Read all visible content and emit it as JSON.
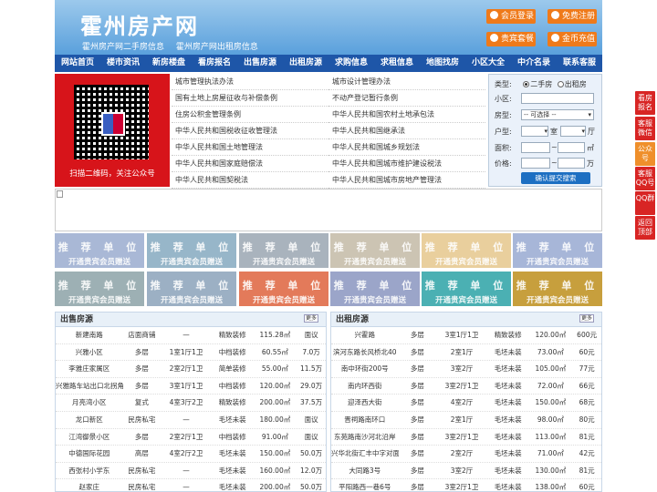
{
  "header": {
    "logo": "霍州房产网",
    "tagline": [
      "霍州房产网二手房信息",
      "霍州房产网出租房信息"
    ],
    "buttons": [
      "会员登录",
      "免费注册",
      "贵宾套餐",
      "金币充值"
    ]
  },
  "nav": [
    "网站首页",
    "楼市资讯",
    "新房楼盘",
    "看房报名",
    "出售房源",
    "出租房源",
    "求购信息",
    "求租信息",
    "地图找房",
    "小区大全",
    "中介名录",
    "联系客服"
  ],
  "qr": {
    "caption": "扫描二维码，关注公众号"
  },
  "laws_left": [
    "城市管理执法办法",
    "国有土地上房屋征收与补偿条例",
    "住房公积金管理条例",
    "中华人民共和国税收征收管理法",
    "中华人民共和国土地管理法",
    "中华人民共和国家庭赔偿法",
    "中华人民共和国契税法"
  ],
  "laws_right": [
    "城市设计管理办法",
    "不动产登记暂行条例",
    "中华人民共和国农村土地承包法",
    "中华人民共和国继承法",
    "中华人民共和国城乡规划法",
    "中华人民共和国城市维护建设税法",
    "中华人民共和国城市房地产管理法"
  ],
  "search": {
    "type_label": "类型:",
    "type_options": [
      "二手房",
      "出租房"
    ],
    "community_label": "小区:",
    "housing_label": "房型:",
    "housing_value": "-- 可选择 --",
    "layout_label": "户型:",
    "room_unit": "室",
    "hall_unit": "厅",
    "area_label": "面积:",
    "area_unit": "㎡",
    "price_label": "价格:",
    "price_unit": "万",
    "tilde": "~",
    "submit": "确认提交搜索"
  },
  "recommend": {
    "title": "推 荐 单 位",
    "subtitle": "开通贵宾会员赠送",
    "colors": [
      "#a9b8d6",
      "#97b6c9",
      "#a9b3bd",
      "#ccc4b3",
      "#e9cf9d",
      "#a7b6d8",
      "#9db0b4",
      "#9cb0c4",
      "#e37a5a",
      "#9ba5c9",
      "#4bb0b3",
      "#c79f3d"
    ]
  },
  "sale": {
    "title": "出售房源",
    "more": "更多",
    "rows": [
      [
        "新建南路",
        "店面商铺",
        "—",
        "精致装修",
        "115.28㎡",
        "面议"
      ],
      [
        "兴雅小区",
        "多层",
        "1室1厅1卫",
        "中档装修",
        "60.55㎡",
        "7.0万"
      ],
      [
        "李雅庄家属区",
        "多层",
        "2室2厅1卫",
        "简单装修",
        "55.00㎡",
        "11.5万"
      ],
      [
        "兴雅路车站出口北拐角",
        "多层",
        "3室1厅1卫",
        "中档装修",
        "120.00㎡",
        "29.0万"
      ],
      [
        "月亮湾小区",
        "复式",
        "4室3厅2卫",
        "精致装修",
        "200.00㎡",
        "37.5万"
      ],
      [
        "龙口新区",
        "民房私宅",
        "—",
        "毛坯未装",
        "180.00㎡",
        "面议"
      ],
      [
        "江湾御景小区",
        "多层",
        "2室2厅1卫",
        "中档装修",
        "91.00㎡",
        "面议"
      ],
      [
        "中德国际花园",
        "高层",
        "4室2厅2卫",
        "毛坯未装",
        "150.00㎡",
        "50.0万"
      ],
      [
        "西张村小学东",
        "民房私宅",
        "—",
        "毛坯未装",
        "160.00㎡",
        "12.0万"
      ],
      [
        "赵家庄",
        "民房私宅",
        "—",
        "毛坯未装",
        "200.00㎡",
        "50.0万"
      ]
    ]
  },
  "rent": {
    "title": "出租房源",
    "more": "更多",
    "rows": [
      [
        "兴霍路",
        "多层",
        "3室1厅1卫",
        "精致装修",
        "120.00㎡",
        "600元"
      ],
      [
        "滨河东路长风桥北40",
        "多层",
        "2室1厅",
        "毛坯未装",
        "73.00㎡",
        "60元"
      ],
      [
        "南中环街200号",
        "多层",
        "3室2厅",
        "毛坯未装",
        "105.00㎡",
        "77元"
      ],
      [
        "南内环西街",
        "多层",
        "3室2厅1卫",
        "毛坯未装",
        "72.00㎡",
        "66元"
      ],
      [
        "迎泽西大街",
        "多层",
        "4室2厅",
        "毛坯未装",
        "150.00㎡",
        "68元"
      ],
      [
        "晋祠路南环口",
        "多层",
        "2室1厅",
        "毛坯未装",
        "98.00㎡",
        "80元"
      ],
      [
        "东苑路南沙河北沿岸",
        "多层",
        "3室2厅1卫",
        "毛坯未装",
        "113.00㎡",
        "81元"
      ],
      [
        "兴华北街汇丰中字对面",
        "多层",
        "2室2厅",
        "毛坯未装",
        "71.00㎡",
        "42元"
      ],
      [
        "大同路3号",
        "多层",
        "3室2厅",
        "毛坯未装",
        "130.00㎡",
        "81元"
      ],
      [
        "平阳路西一巷6号",
        "多层",
        "3室2厅1卫",
        "毛坯未装",
        "138.00㎡",
        "60元"
      ]
    ]
  },
  "side": [
    "看房报名",
    "客服微信",
    "公众号",
    "客服QQ号",
    "QQ群",
    "返回顶部"
  ]
}
